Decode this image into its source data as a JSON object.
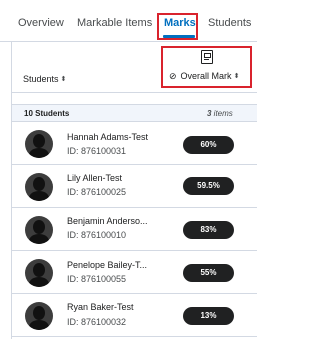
{
  "tabs": [
    {
      "label": "Overview",
      "active": false
    },
    {
      "label": "Markable Items",
      "active": false
    },
    {
      "label": "Marks",
      "active": true
    },
    {
      "label": "Students",
      "active": false
    }
  ],
  "header": {
    "students_label": "Students",
    "sort_glyph": "⬍",
    "overall_mark_label": "Overall Mark",
    "hidden_glyph": "⊘"
  },
  "summary": {
    "students_count": "10 Students",
    "items_count": "3",
    "items_suffix": " items"
  },
  "students": [
    {
      "name": "Hannah Adams-Test",
      "id": "ID: 876100031",
      "mark": "60%"
    },
    {
      "name": "Lily Allen-Test",
      "id": "ID: 876100025",
      "mark": "59.5%"
    },
    {
      "name": "Benjamin Anderso...",
      "id": "ID: 876100010",
      "mark": "83%"
    },
    {
      "name": "Penelope Bailey-T...",
      "id": "ID: 876100055",
      "mark": "55%"
    },
    {
      "name": "Ryan Baker-Test",
      "id": "ID: 876100032",
      "mark": "13%"
    }
  ],
  "colors": {
    "accent": "#006fbf",
    "highlight": "#d9232d",
    "badge_bg": "#202122"
  },
  "icons": [
    "avatar-placeholder-icon",
    "sort-icon",
    "hidden-eye-icon",
    "gradebook-icon"
  ]
}
